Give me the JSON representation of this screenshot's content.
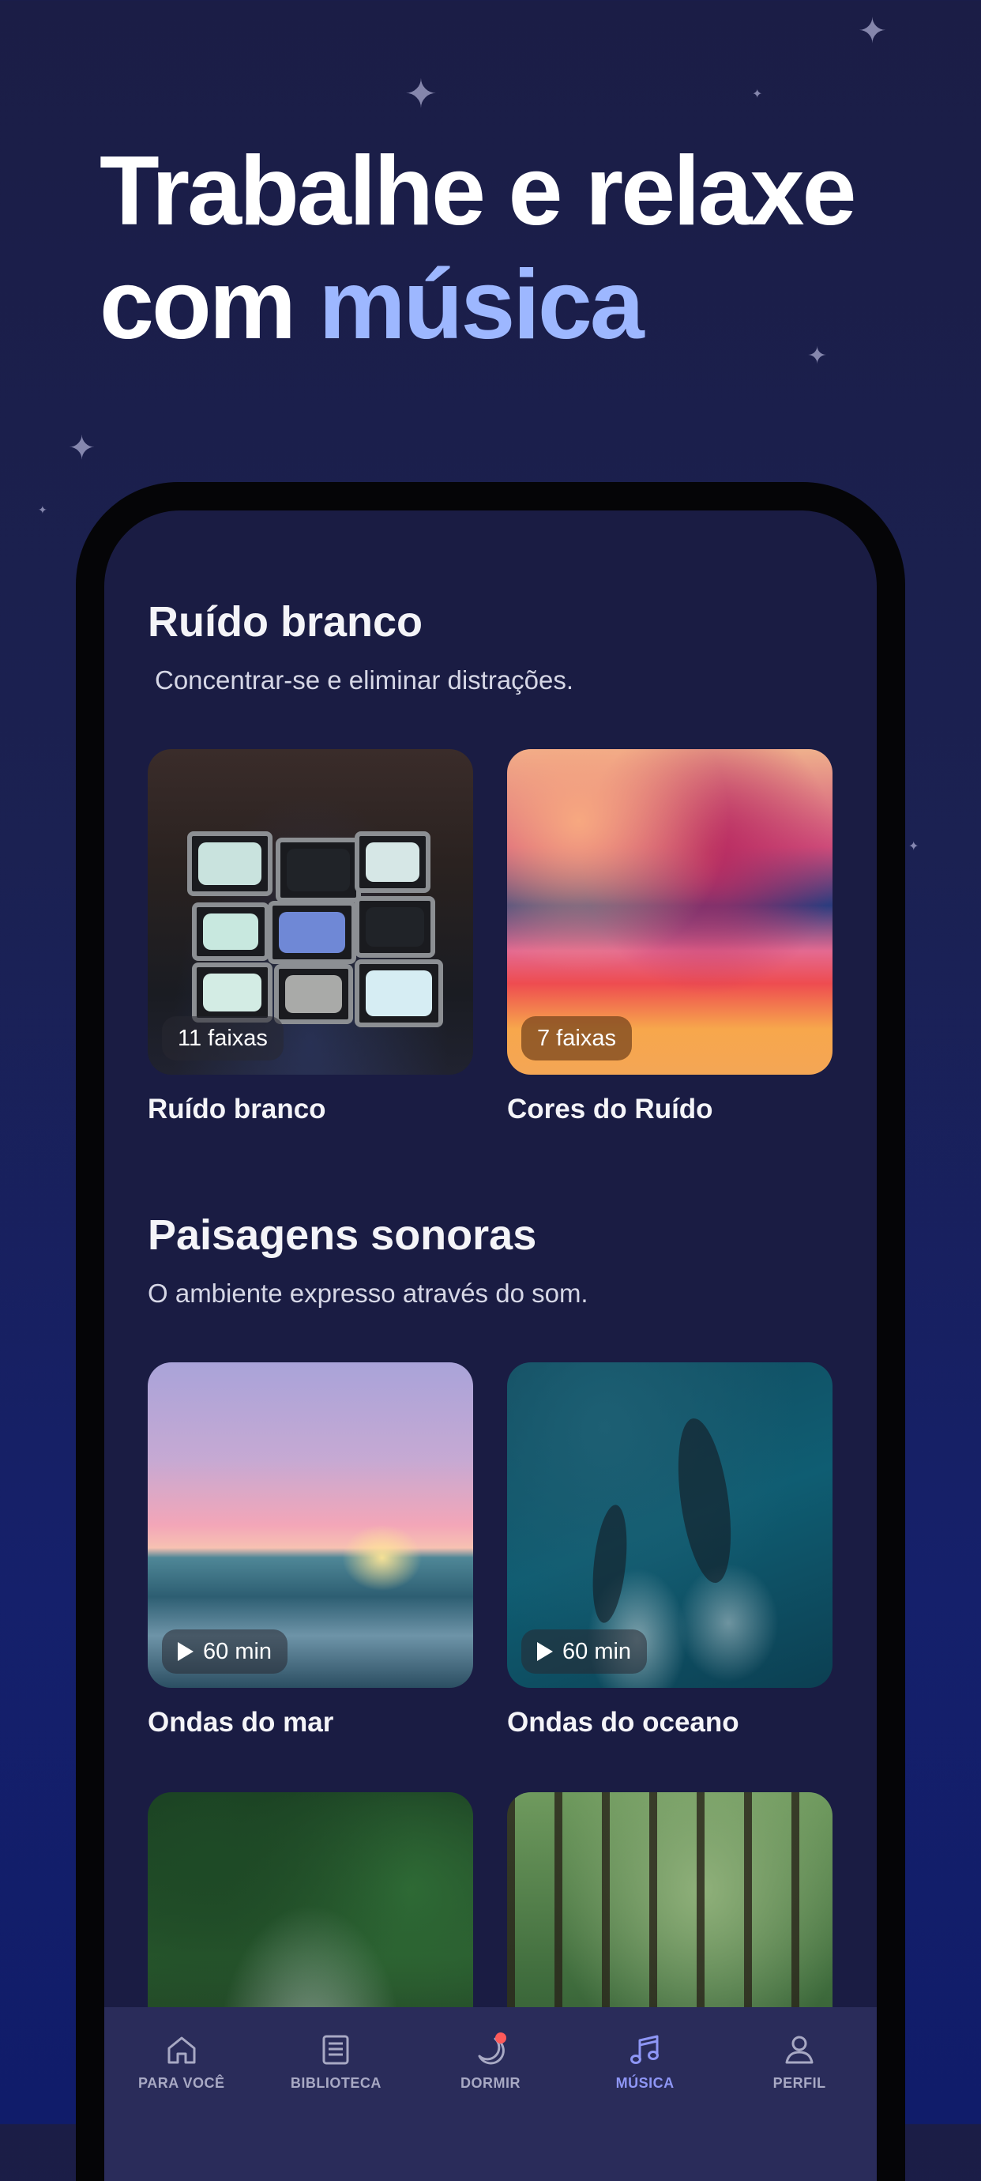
{
  "headline": {
    "line1": "Trabalhe e relaxe",
    "line2_prefix": "com ",
    "line2_accent": "música"
  },
  "colors": {
    "accent": "#9db7ff",
    "tab_active": "#8e96f5",
    "notification_dot": "#ff5a5a"
  },
  "sections": [
    {
      "title": "Ruído branco",
      "subtitle": "Concentrar-se e eliminar distrações.",
      "cards": [
        {
          "title": "Ruído branco",
          "badge": "11 faixas"
        },
        {
          "title": "Cores do Ruído",
          "badge": "7 faixas"
        }
      ]
    },
    {
      "title": "Paisagens sonoras",
      "subtitle": "O ambiente expresso através do som.",
      "cards": [
        {
          "title": "Ondas do mar",
          "badge": "60 min"
        },
        {
          "title": "Ondas do oceano",
          "badge": "60 min"
        }
      ]
    }
  ],
  "tabbar": {
    "items": [
      {
        "label": "PARA VOCÊ",
        "icon": "home-icon",
        "active": false
      },
      {
        "label": "BIBLIOTECA",
        "icon": "library-icon",
        "active": false
      },
      {
        "label": "DORMIR",
        "icon": "moon-icon",
        "active": false,
        "has_notification": true
      },
      {
        "label": "MÚSICA",
        "icon": "music-note-icon",
        "active": true
      },
      {
        "label": "PERFIL",
        "icon": "person-icon",
        "active": false
      }
    ]
  }
}
